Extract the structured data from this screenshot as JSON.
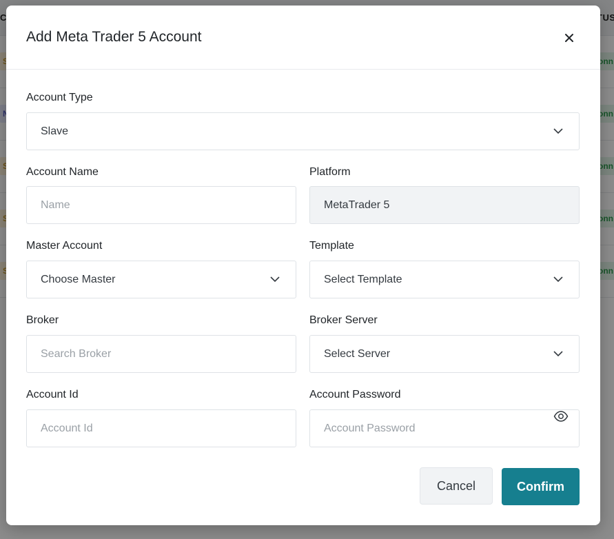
{
  "background": {
    "header_left": "C",
    "header_right": "TUS",
    "rows": [
      {
        "left_chip": "S",
        "left_color": "#c99a2e",
        "left_bg": "#fdf1d8",
        "right_chip": "onn",
        "right_color": "#2e9b4e",
        "right_bg": "#e2f5e7"
      },
      {
        "left_chip": "N",
        "left_color": "#5a5fc7",
        "left_bg": "#e6e7fb",
        "right_chip": "onn",
        "right_color": "#2e9b4e",
        "right_bg": "#e2f5e7"
      },
      {
        "left_chip": "S",
        "left_color": "#c99a2e",
        "left_bg": "#fdf1d8",
        "right_chip": "onn",
        "right_color": "#2e9b4e",
        "right_bg": "#e2f5e7"
      },
      {
        "left_chip": "S",
        "left_color": "#c99a2e",
        "left_bg": "#fdf1d8",
        "right_chip": "onn",
        "right_color": "#2e9b4e",
        "right_bg": "#e2f5e7"
      },
      {
        "left_chip": "S",
        "left_color": "#c99a2e",
        "left_bg": "#fdf1d8",
        "right_chip": "onn",
        "right_color": "#2e9b4e",
        "right_bg": "#e2f5e7"
      }
    ]
  },
  "modal": {
    "title": "Add Meta Trader 5 Account",
    "close_icon": "close-icon",
    "fields": {
      "account_type": {
        "label": "Account Type",
        "value": "Slave"
      },
      "account_name": {
        "label": "Account Name",
        "placeholder": "Name",
        "value": ""
      },
      "platform": {
        "label": "Platform",
        "value": "MetaTrader 5"
      },
      "master_account": {
        "label": "Master Account",
        "value": "Choose Master"
      },
      "template": {
        "label": "Template",
        "value": "Select Template"
      },
      "broker": {
        "label": "Broker",
        "placeholder": "Search Broker",
        "value": ""
      },
      "broker_server": {
        "label": "Broker Server",
        "value": "Select Server"
      },
      "account_id": {
        "label": "Account Id",
        "placeholder": "Account Id",
        "value": ""
      },
      "account_password": {
        "label": "Account Password",
        "placeholder": "Account Password",
        "value": "",
        "icon": "eye-icon"
      }
    },
    "buttons": {
      "cancel": "Cancel",
      "confirm": "Confirm"
    }
  },
  "colors": {
    "accent": "#167f8f",
    "overlay": "rgba(0,0,0,0.45)"
  }
}
